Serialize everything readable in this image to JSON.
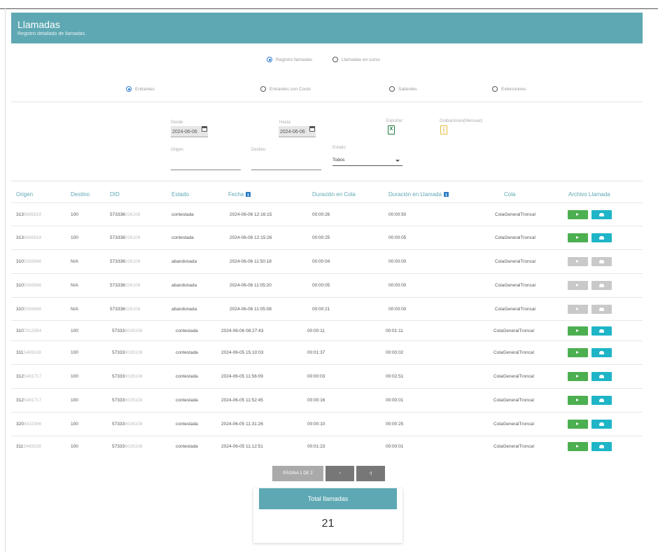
{
  "header": {
    "title": "Llamadas",
    "subtitle": "Registro detallado de llamadas."
  },
  "view_mode": {
    "options": [
      {
        "label": "Registro llamadas",
        "selected": true
      },
      {
        "label": "Llamadas en curso",
        "selected": false
      }
    ]
  },
  "call_type": {
    "options": [
      {
        "label": "Entrantes",
        "selected": true
      },
      {
        "label": "Entrantes con Costo",
        "selected": false
      },
      {
        "label": "Salientes",
        "selected": false
      },
      {
        "label": "Extensiones",
        "selected": false
      }
    ]
  },
  "filters": {
    "desde_label": "Desde",
    "desde_value": "2024-06-06",
    "hasta_label": "Hasta",
    "hasta_value": "2024-06-06",
    "exportar_label": "Exportar:",
    "grabaciones_label": "Grabaciones(Mensual):",
    "origen_label": "Origen",
    "destino_label": "Destino",
    "estado_label": "Estado",
    "estado_value": "Todos",
    "xls_glyph": "X"
  },
  "columns": [
    "Origen",
    "Destino",
    "DID",
    "Estado",
    "Fecha",
    "Duración en Cola",
    "Duración en Llamada",
    "Cola",
    "Archivo Llamada"
  ],
  "rows": [
    {
      "origen_a": "313",
      "origen_b": "6685818",
      "destino": "100",
      "did_a": "573336",
      "did_b": "026108",
      "estado": "contestada",
      "fecha": "2024-06-06 12:16:15",
      "cola_dur": "00:00:26",
      "llamada_dur": "00:00:50",
      "cola": "ColaGeneralTroncal",
      "audio": true
    },
    {
      "origen_a": "313",
      "origen_b": "6685818",
      "destino": "100",
      "did_a": "573336",
      "did_b": "026108",
      "estado": "contestada",
      "fecha": "2024-06-06 12:15:26",
      "cola_dur": "00:00:25",
      "llamada_dur": "00:00:05",
      "cola": "ColaGeneralTroncal",
      "audio": true
    },
    {
      "origen_a": "310",
      "origen_b": "5565666",
      "destino": "N/A",
      "did_a": "573336",
      "did_b": "026108",
      "estado": "abandonada",
      "fecha": "2024-06-06 11:50:18",
      "cola_dur": "00:00:04",
      "llamada_dur": "00:00:00",
      "cola": "ColaGeneralTroncal",
      "audio": false
    },
    {
      "origen_a": "310",
      "origen_b": "5565666",
      "destino": "N/A",
      "did_a": "573336",
      "did_b": "026108",
      "estado": "abandonada",
      "fecha": "2024-06-06 11:05:20",
      "cola_dur": "00:00:05",
      "llamada_dur": "00:00:00",
      "cola": "ColaGeneralTroncal",
      "audio": false
    },
    {
      "origen_a": "310",
      "origen_b": "5565666",
      "destino": "N/A",
      "did_a": "573336",
      "did_b": "026108",
      "estado": "abandonada",
      "fecha": "2024-06-06 11:05:08",
      "cola_dur": "00:00:21",
      "llamada_dur": "00:00:00",
      "cola": "ColaGeneralTroncal",
      "audio": false
    },
    {
      "origen_a": "310",
      "origen_b": "7912954",
      "destino": "100",
      "did_a": "57333",
      "did_b": "6026108",
      "estado": "contestada",
      "fecha": "2024-06-06 08:27:43",
      "cola_dur": "00:00:11",
      "llamada_dur": "00:01:11",
      "cola": "ColaGeneralTroncal",
      "audio": true
    },
    {
      "origen_a": "311",
      "origen_b": "5465538",
      "destino": "100",
      "did_a": "57333",
      "did_b": "6026108",
      "estado": "contestada",
      "fecha": "2024-06-05 15:10:03",
      "cola_dur": "00:01:37",
      "llamada_dur": "00:00:02",
      "cola": "ColaGeneralTroncal",
      "audio": true
    },
    {
      "origen_a": "312",
      "origen_b": "5481717",
      "destino": "100",
      "did_a": "57333",
      "did_b": "6026108",
      "estado": "contestada",
      "fecha": "2024-06-05 11:56:09",
      "cola_dur": "00:00:03",
      "llamada_dur": "00:02:51",
      "cola": "ColaGeneralTroncal",
      "audio": true
    },
    {
      "origen_a": "312",
      "origen_b": "5481717",
      "destino": "100",
      "did_a": "57333",
      "did_b": "6026108",
      "estado": "contestada",
      "fecha": "2024-06-05 11:52:45",
      "cola_dur": "00:00:16",
      "llamada_dur": "00:00:01",
      "cola": "ColaGeneralTroncal",
      "audio": true
    },
    {
      "origen_a": "320",
      "origen_b": "4532906",
      "destino": "100",
      "did_a": "57333",
      "did_b": "6026108",
      "estado": "contestada",
      "fecha": "2024-06-05 11:31:26",
      "cola_dur": "00:00:10",
      "llamada_dur": "00:00:25",
      "cola": "ColaGeneralTroncal",
      "audio": true
    },
    {
      "origen_a": "311",
      "origen_b": "5465538",
      "destino": "100",
      "did_a": "57333",
      "did_b": "6026108",
      "estado": "contestada",
      "fecha": "2024-06-05 11:12:51",
      "cola_dur": "00:01:23",
      "llamada_dur": "00:00:01",
      "cola": "ColaGeneralTroncal",
      "audio": true
    }
  ],
  "pagination": {
    "label": "PÁGINA 1 DE 2",
    "next": "›",
    "last": "›|"
  },
  "total": {
    "label": "Total llamadas",
    "value": "21"
  }
}
